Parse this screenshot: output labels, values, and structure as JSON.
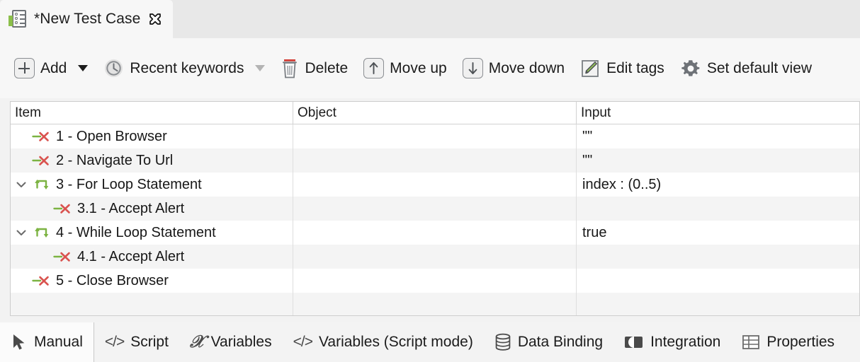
{
  "document_tab": {
    "title": "*New Test Case",
    "icon": "test-case-icon",
    "close_icon": "close-icon"
  },
  "toolbar": {
    "add_label": "Add",
    "add_icon": "plus-box-icon",
    "add_caret_icon": "chevron-down-icon",
    "recent_keywords_label": "Recent keywords",
    "recent_keywords_icon": "clock-icon",
    "recent_keywords_caret_icon": "chevron-down-icon",
    "delete_label": "Delete",
    "delete_icon": "trash-icon",
    "move_up_label": "Move up",
    "move_up_icon": "arrow-up-icon",
    "move_down_label": "Move down",
    "move_down_icon": "arrow-down-icon",
    "edit_tags_label": "Edit tags",
    "edit_tags_icon": "pencil-edit-icon",
    "set_default_view_label": "Set default view",
    "set_default_view_icon": "gear-icon"
  },
  "table": {
    "columns": [
      "Item",
      "Object",
      "Input"
    ],
    "rows": [
      {
        "item": "1 - Open Browser",
        "object": "",
        "input": "\"\"",
        "icon": "keyword-icon",
        "indent": 0,
        "expandable": false,
        "expanded": false
      },
      {
        "item": "2 - Navigate To Url",
        "object": "",
        "input": "\"\"",
        "icon": "keyword-icon",
        "indent": 0,
        "expandable": false,
        "expanded": false
      },
      {
        "item": "3 - For Loop Statement",
        "object": "",
        "input": "index : (0..5)",
        "icon": "loop-icon",
        "indent": 0,
        "expandable": true,
        "expanded": true
      },
      {
        "item": "3.1 - Accept Alert",
        "object": "",
        "input": "",
        "icon": "keyword-icon",
        "indent": 1,
        "expandable": false,
        "expanded": false
      },
      {
        "item": "4 - While Loop Statement",
        "object": "",
        "input": "true",
        "icon": "loop-icon",
        "indent": 0,
        "expandable": true,
        "expanded": true
      },
      {
        "item": "4.1 - Accept Alert",
        "object": "",
        "input": "",
        "icon": "keyword-icon",
        "indent": 1,
        "expandable": false,
        "expanded": false
      },
      {
        "item": "5 - Close Browser",
        "object": "",
        "input": "",
        "icon": "keyword-icon",
        "indent": 0,
        "expandable": false,
        "expanded": false
      },
      {
        "item": "",
        "object": "",
        "input": "",
        "icon": "",
        "indent": 0,
        "expandable": false,
        "expanded": false
      }
    ]
  },
  "bottom_tabs": [
    {
      "label": "Manual",
      "icon": "cursor-arrow-icon",
      "active": true
    },
    {
      "label": "Script",
      "icon": "code-icon",
      "active": false
    },
    {
      "label": "Variables",
      "icon": "variable-x-icon",
      "active": false
    },
    {
      "label": "Variables (Script mode)",
      "icon": "code-icon",
      "active": false
    },
    {
      "label": "Data Binding",
      "icon": "database-icon",
      "active": false
    },
    {
      "label": "Integration",
      "icon": "integration-icon",
      "active": false
    },
    {
      "label": "Properties",
      "icon": "table-grid-icon",
      "active": false
    }
  ],
  "colors": {
    "keyword_green": "#7cb342",
    "keyword_red": "#d9534f",
    "loop_green": "#7cb342",
    "accent_gray": "#6e7277",
    "row_alt": "#f4f4f4"
  }
}
